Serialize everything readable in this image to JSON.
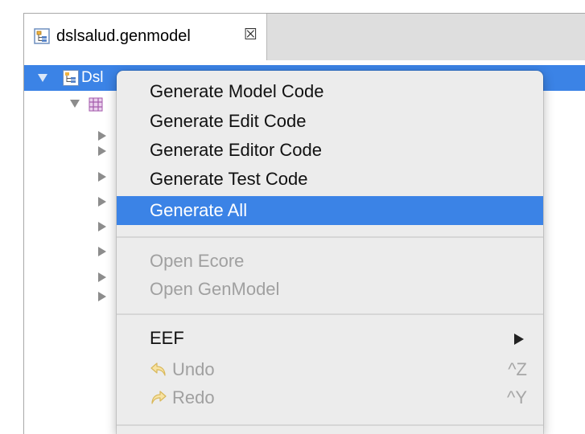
{
  "editor": {
    "tab": {
      "label": "dslsalud.genmodel",
      "icon": "genmodel-file-icon",
      "close_glyph": "☒"
    },
    "tree": {
      "root_label": "Dsl"
    }
  },
  "context_menu": {
    "items": [
      {
        "label": "Generate Model Code"
      },
      {
        "label": "Generate Edit Code"
      },
      {
        "label": "Generate Editor Code"
      },
      {
        "label": "Generate Test Code"
      },
      {
        "label": "Generate All",
        "highlighted": true
      },
      {
        "label": "Open Ecore",
        "disabled": true
      },
      {
        "label": "Open GenModel",
        "disabled": true
      },
      {
        "label": "EEF",
        "submenu": true
      },
      {
        "label": "Undo",
        "disabled": true,
        "shortcut": "^Z",
        "icon": "undo-icon"
      },
      {
        "label": "Redo",
        "disabled": true,
        "shortcut": "^Y",
        "icon": "redo-icon"
      }
    ]
  },
  "colors": {
    "selection": "#3b83e6",
    "menu_background": "#ececec",
    "disabled_text": "#a0a0a0"
  }
}
